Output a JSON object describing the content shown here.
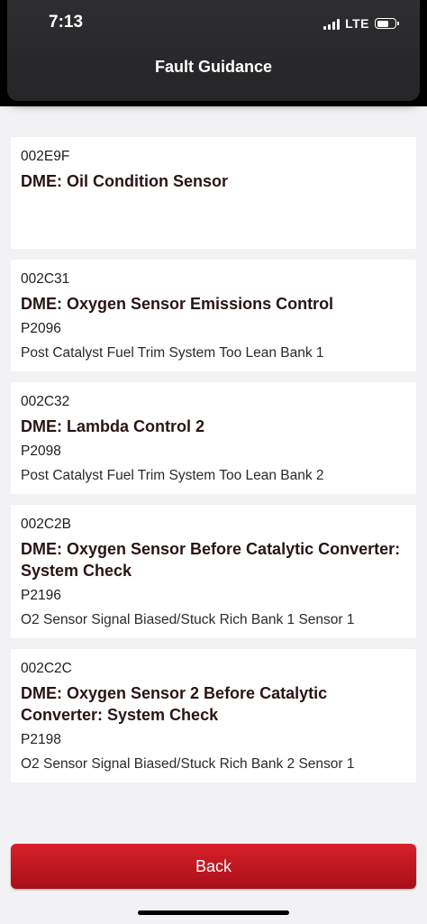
{
  "status_bar": {
    "time": "7:13",
    "network": "LTE"
  },
  "header": {
    "title": "Fault Guidance"
  },
  "faults": [
    {
      "code": "002E9F",
      "title": "DME: Oil Condition Sensor",
      "pcode": "",
      "description": ""
    },
    {
      "code": "002C31",
      "title": "DME: Oxygen Sensor Emissions Control",
      "pcode": "P2096",
      "description": "Post Catalyst Fuel Trim System Too Lean Bank 1"
    },
    {
      "code": "002C32",
      "title": "DME: Lambda Control 2",
      "pcode": "P2098",
      "description": "Post Catalyst Fuel Trim System Too Lean Bank 2"
    },
    {
      "code": "002C2B",
      "title": "DME: Oxygen Sensor Before Catalytic Converter: System Check",
      "pcode": "P2196",
      "description": "O2 Sensor Signal Biased/Stuck Rich Bank 1 Sensor 1"
    },
    {
      "code": "002C2C",
      "title": "DME: Oxygen Sensor 2 Before Catalytic Converter: System Check",
      "pcode": "P2198",
      "description": "O2 Sensor Signal Biased/Stuck Rich Bank 2 Sensor 1"
    }
  ],
  "footer": {
    "back_label": "Back"
  },
  "colors": {
    "accent": "#c8141e",
    "header_bg": "#2a2a2c",
    "page_bg": "#f2f2f4"
  }
}
